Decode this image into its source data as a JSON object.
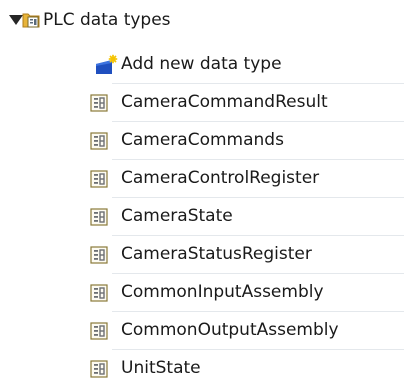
{
  "tree": {
    "root": {
      "label": "PLC data types",
      "icon": "folder-datatype-icon",
      "expanded": true
    },
    "add_item": {
      "label": "Add new data type",
      "icon": "add-new-icon"
    },
    "items": [
      {
        "label": "CameraCommandResult",
        "icon": "data-type-icon"
      },
      {
        "label": "CameraCommands",
        "icon": "data-type-icon"
      },
      {
        "label": "CameraControlRegister",
        "icon": "data-type-icon"
      },
      {
        "label": "CameraState",
        "icon": "data-type-icon"
      },
      {
        "label": "CameraStatusRegister",
        "icon": "data-type-icon"
      },
      {
        "label": "CommonInputAssembly",
        "icon": "data-type-icon"
      },
      {
        "label": "CommonOutputAssembly",
        "icon": "data-type-icon"
      },
      {
        "label": "UnitState",
        "icon": "data-type-icon"
      }
    ]
  },
  "colors": {
    "text": "#1a1a1a",
    "folder": "#e8b43a",
    "icon_stroke": "#7a6a2a",
    "accent_blue": "#1f4fbf",
    "divider": "#e4e8ec"
  }
}
